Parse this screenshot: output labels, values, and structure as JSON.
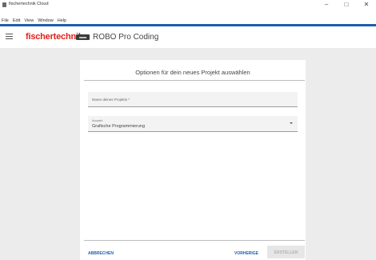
{
  "window": {
    "title": "fischertechnik Cloud",
    "controls": {
      "minimize": "–",
      "maximize": "□",
      "close": "✕"
    }
  },
  "menu": [
    "File",
    "Edit",
    "View",
    "Window",
    "Help"
  ],
  "appbar": {
    "brand": "fischertechnik",
    "title": "ROBO Pro Coding"
  },
  "dialog": {
    "title": "Optionen für dein neues Projekt auswählen",
    "name_field": {
      "placeholder": "Name deines Projekts *",
      "value": ""
    },
    "type_field": {
      "label": "Auswahl",
      "value": "Grafische Programmierung"
    },
    "buttons": {
      "cancel": "ABBRECHEN",
      "previous": "VORHERIGE",
      "create": "ERSTELLEN"
    }
  },
  "colors": {
    "accent": "#1f5eab",
    "brand": "#e2201a",
    "disabled_button": "#e6e6e6"
  }
}
